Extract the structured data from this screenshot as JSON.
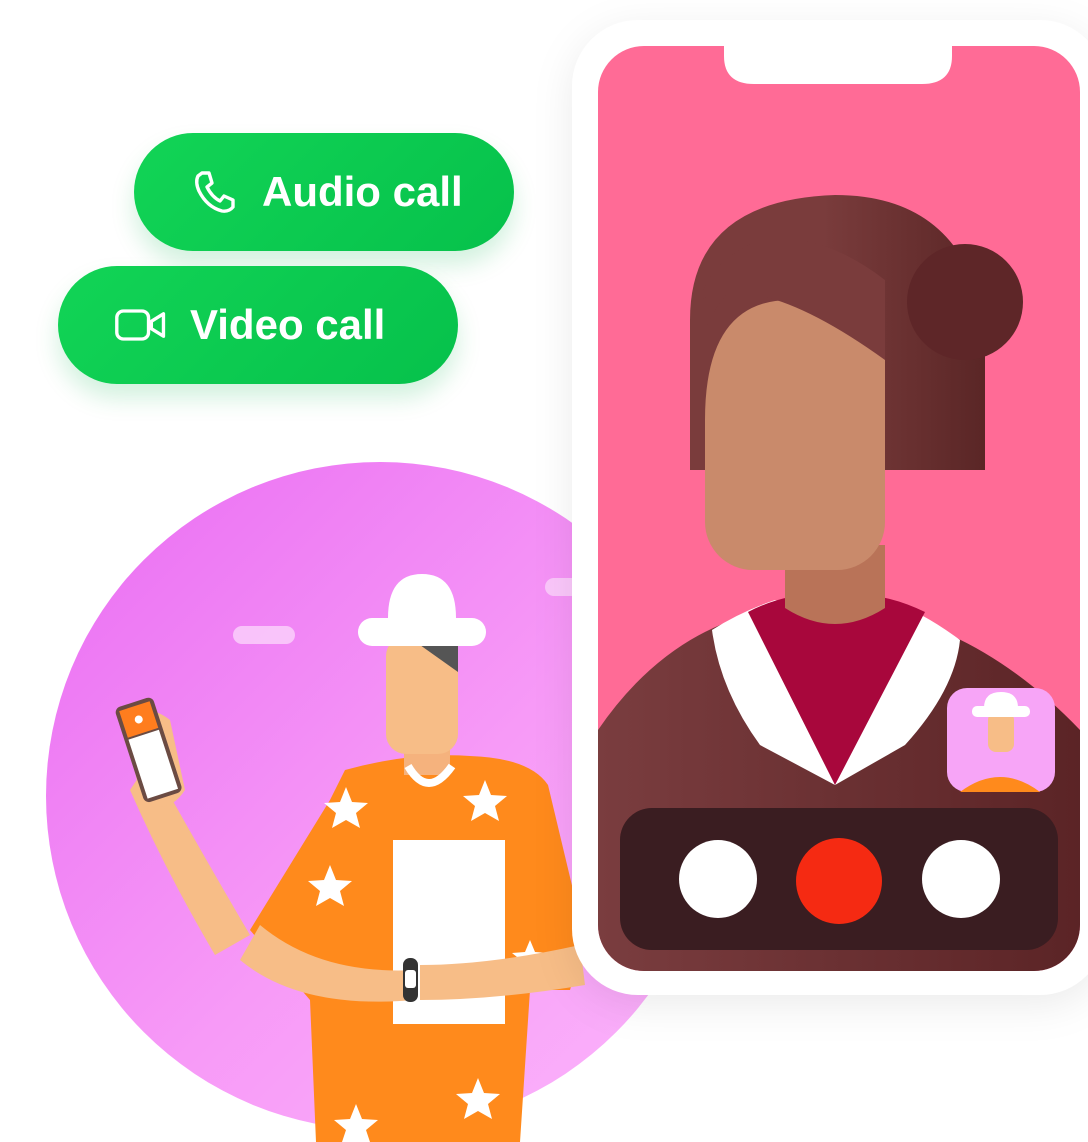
{
  "call_options": {
    "audio_label": "Audio call",
    "video_label": "Video call"
  },
  "icons": {
    "audio": "phone-icon",
    "video": "video-camera-icon"
  },
  "colors": {
    "call_button": "#0ecb52",
    "circle_background": "#f27cf7",
    "phone_screen": "#ff6b96",
    "end_call": "#f52a12",
    "controls_bar": "#3a1d21",
    "shirt": "#ff8a1c"
  }
}
